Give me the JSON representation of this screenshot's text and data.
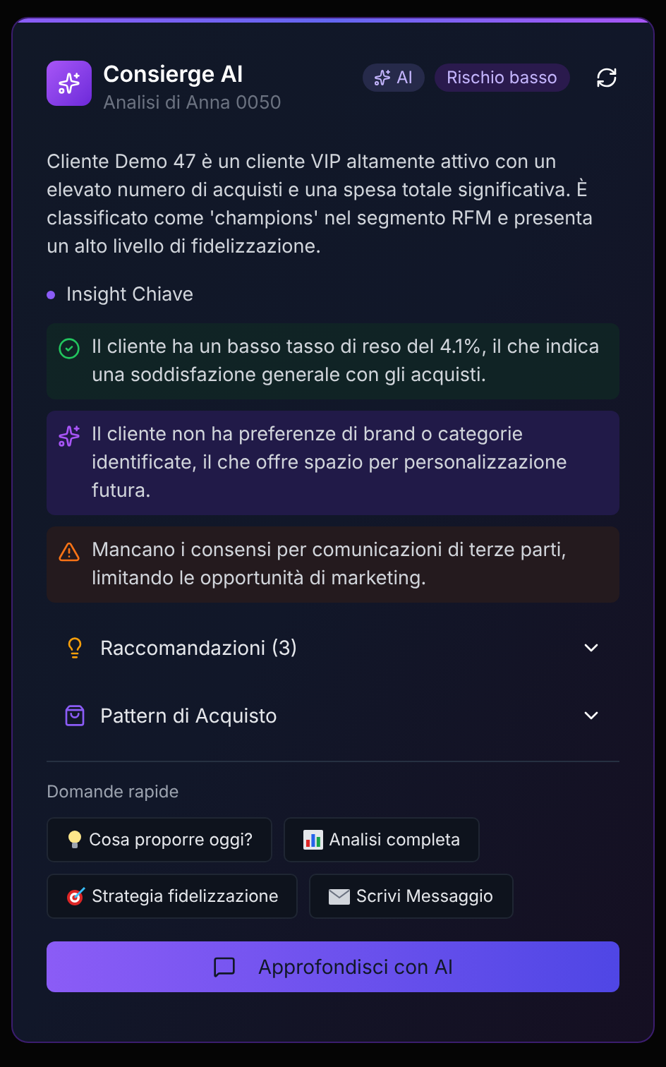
{
  "header": {
    "title": "Consierge AI",
    "subtitle": "Analisi di Anna 0050",
    "badges": [
      {
        "kind": "ai",
        "label": "AI"
      },
      {
        "kind": "risk",
        "label": "Rischio basso"
      }
    ]
  },
  "summary": "Cliente Demo 47 è un cliente VIP altamente attivo con un elevato numero di acquisti e una spesa totale significativa. È classificato come 'champions' nel segmento RFM e presenta un alto livello di fidelizzazione.",
  "insights_title": "Insight Chiave",
  "insights": [
    {
      "kind": "success",
      "text": "Il cliente ha un basso tasso di reso del 4.1%, il che indica una soddisfazione generale con gli acquisti."
    },
    {
      "kind": "idea",
      "text": "Il cliente non ha preferenze di brand o categorie identificate, il che offre spazio per personalizzazione futura."
    },
    {
      "kind": "warning",
      "text": "Mancano i consensi per comunicazioni di terze parti, limitando le opportunità di marketing."
    }
  ],
  "sections": [
    {
      "kind": "bulb",
      "label": "Raccomandazioni (3)",
      "expanded": false
    },
    {
      "kind": "bag",
      "label": "Pattern di Acquisto",
      "expanded": false
    }
  ],
  "quick_title": "Domande rapide",
  "quick": [
    {
      "kind": "bulb",
      "label": "Cosa proporre oggi?"
    },
    {
      "kind": "chart",
      "label": "Analisi completa"
    },
    {
      "kind": "target",
      "label": "Strategia fidelizzazione"
    },
    {
      "kind": "mail",
      "label": "Scrivi Messaggio"
    }
  ],
  "cta": "Approfondisci con AI"
}
